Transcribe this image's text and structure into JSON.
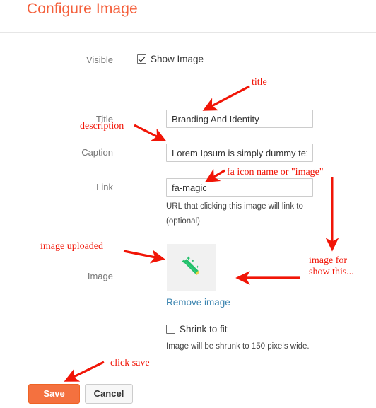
{
  "header": {
    "title": "Configure Image"
  },
  "form": {
    "visible": {
      "label": "Visible",
      "checkbox_label": "Show Image",
      "checked": true
    },
    "title": {
      "label": "Title",
      "value": "Branding And Identity"
    },
    "caption": {
      "label": "Caption",
      "value": "Lorem Ipsum is simply dummy text"
    },
    "link": {
      "label": "Link",
      "value": "fa-magic",
      "help_line1": "URL that clicking this image will link to",
      "help_line2": "(optional)"
    },
    "image": {
      "label": "Image",
      "icon": "magic-wand-icon",
      "remove_label": "Remove image"
    },
    "shrink": {
      "checkbox_label": "Shrink to fit",
      "checked": false,
      "help": "Image will be shrunk to 150 pixels wide."
    }
  },
  "buttons": {
    "save": "Save",
    "cancel": "Cancel"
  },
  "annotations": {
    "title": "title",
    "description": "description",
    "icon_name": "fa icon name or \"image\"",
    "image_uploaded": "image uploaded",
    "image_for_show": "image for show this...",
    "click_save": "click save"
  },
  "colors": {
    "header_title": "#f4603c",
    "annotation": "#f11507",
    "save_button": "#f4713f",
    "link": "#3d85b0",
    "wand_green": "#22c06a",
    "wand_tip": "#e8d44d"
  }
}
